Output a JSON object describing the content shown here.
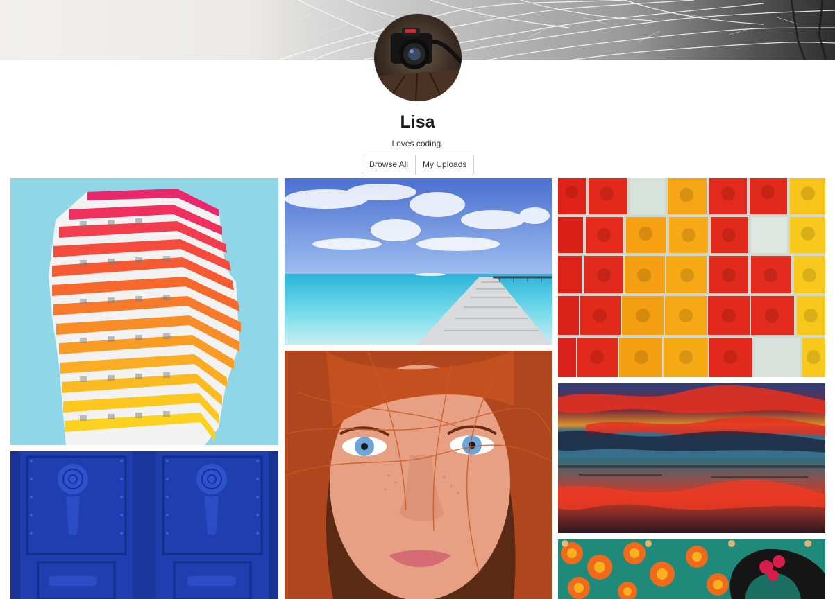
{
  "profile": {
    "name": "Lisa",
    "bio": "Loves coding."
  },
  "tabs": [
    {
      "label": "Browse All"
    },
    {
      "label": "My Uploads"
    }
  ],
  "colors": {
    "accent_border": "#cccccc",
    "text": "#1a1a1a"
  },
  "gallery": {
    "photos": [
      {
        "subject": "orange-building"
      },
      {
        "subject": "beach-pier"
      },
      {
        "subject": "tomatoes"
      },
      {
        "subject": "blue-door"
      },
      {
        "subject": "redhead-portrait"
      },
      {
        "subject": "sunset-reflection"
      },
      {
        "subject": "flower-art"
      }
    ]
  }
}
